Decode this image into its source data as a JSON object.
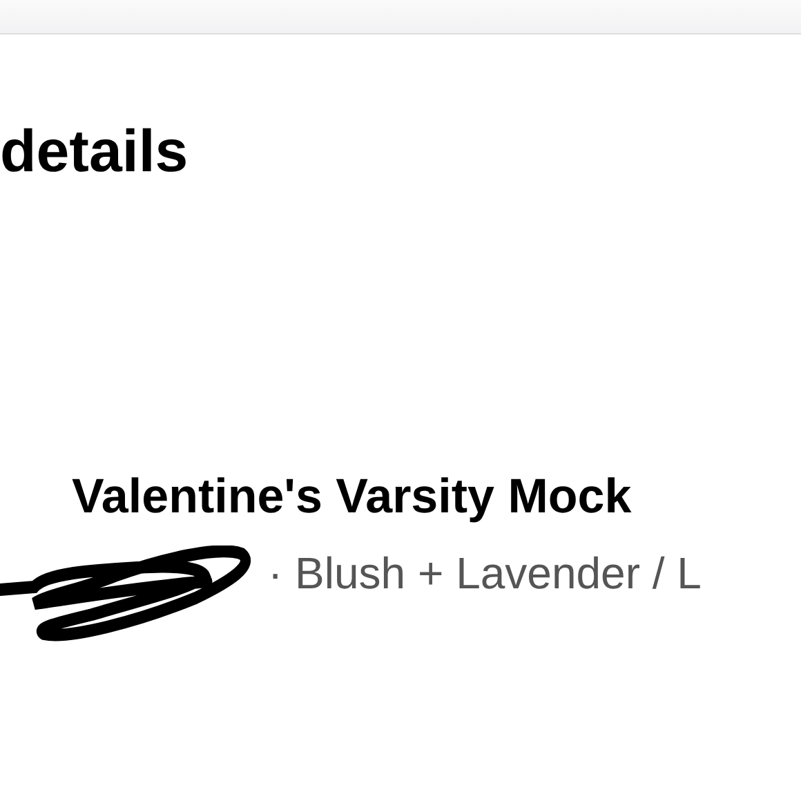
{
  "section": {
    "heading": "details"
  },
  "item": {
    "title": "Valentine's Varsity Mock",
    "options": "· Blush + Lavender / L"
  }
}
